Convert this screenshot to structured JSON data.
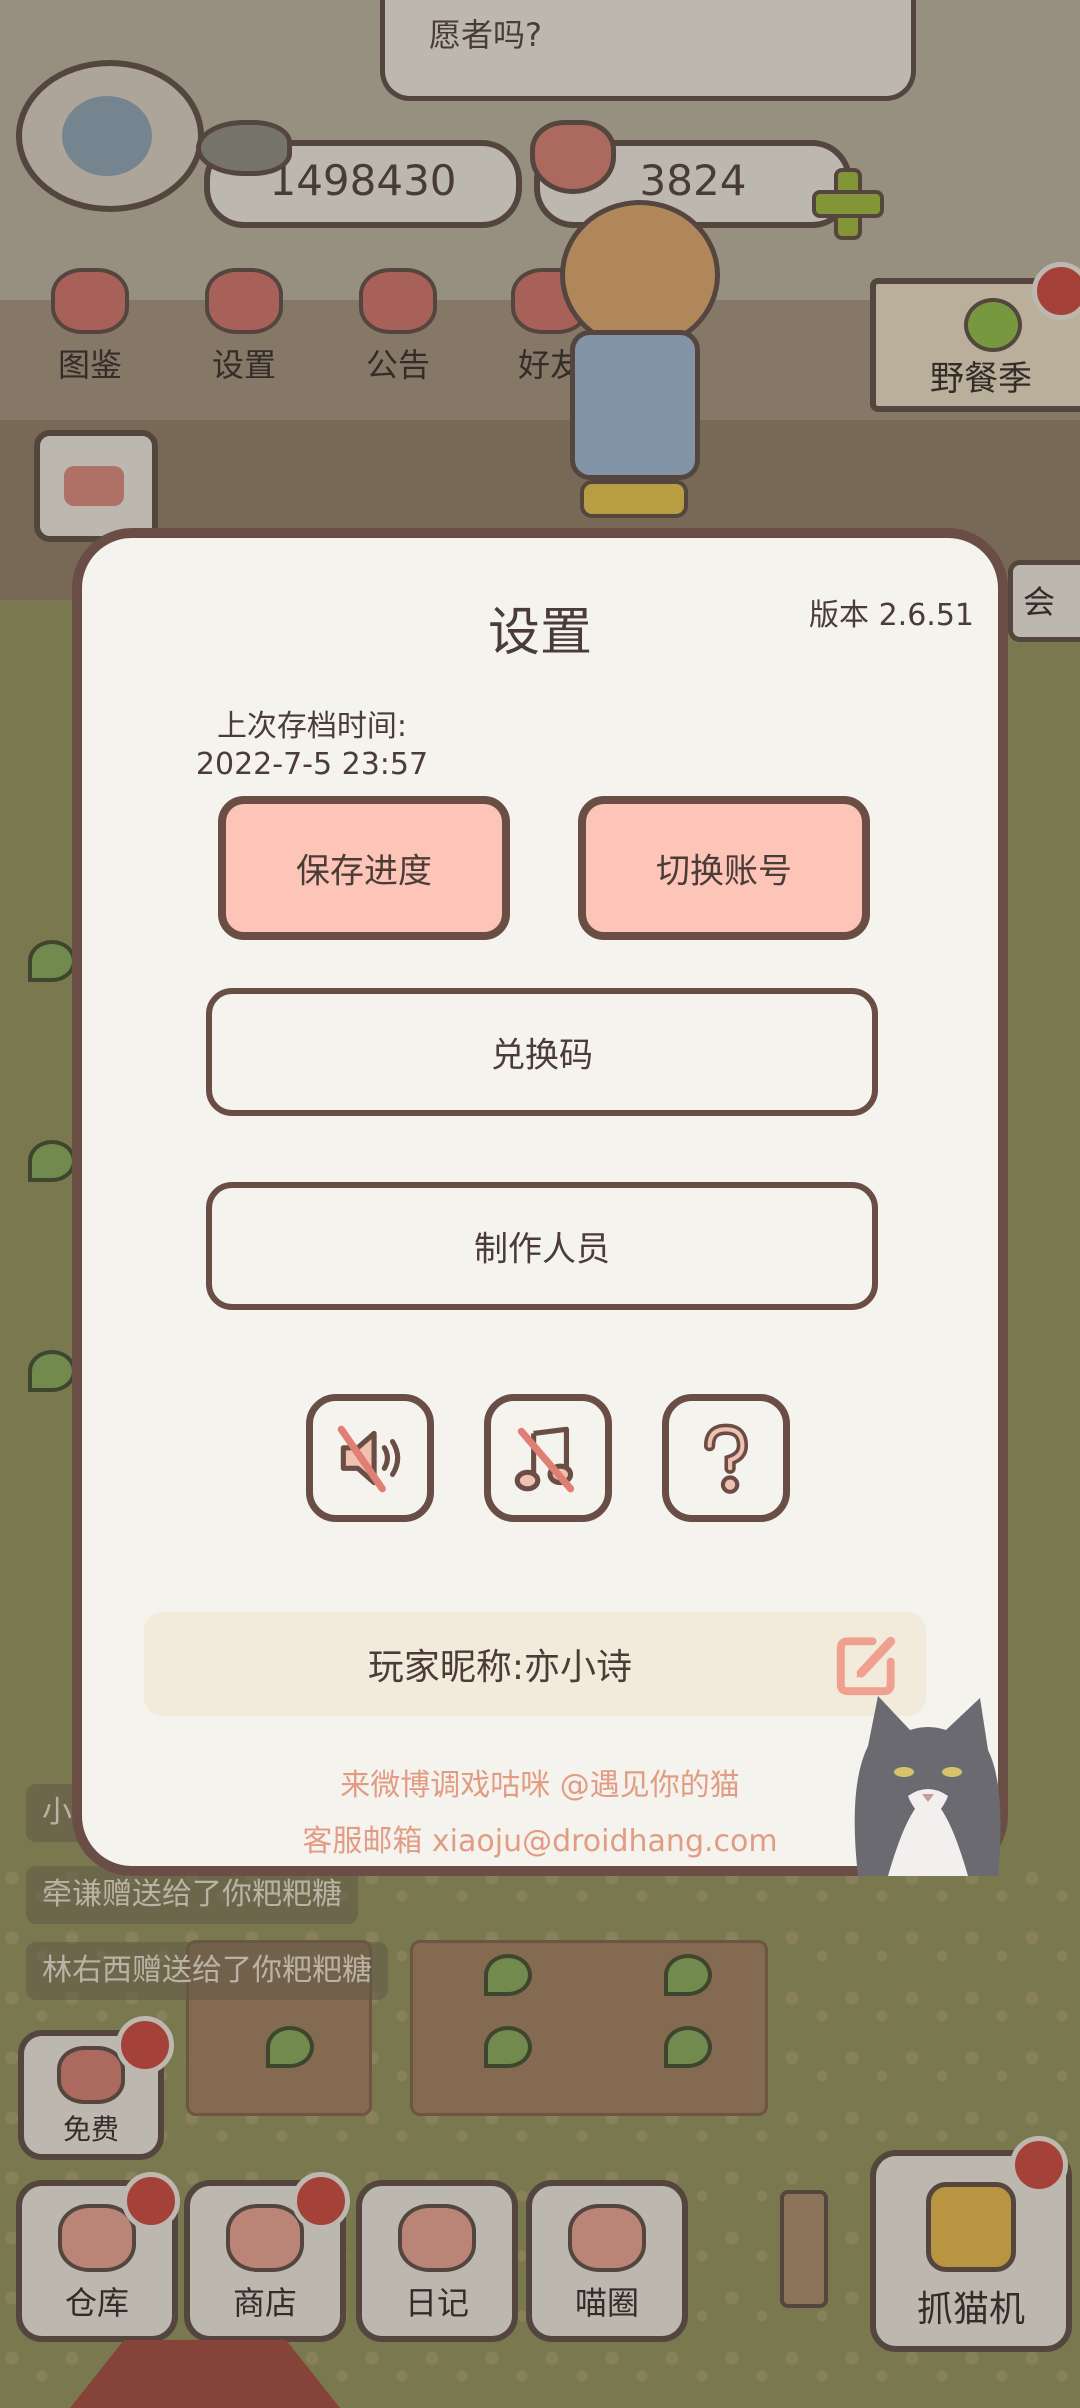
{
  "speech_bubble": "愿者吗?",
  "currencies": {
    "coins": "1498430",
    "hearts": "3824"
  },
  "top_nav": [
    {
      "label": "图鉴",
      "icon": "cat-book-icon"
    },
    {
      "label": "设置",
      "icon": "gear-icon"
    },
    {
      "label": "公告",
      "icon": "gift-icon"
    },
    {
      "label": "好友",
      "icon": "friends-icon"
    }
  ],
  "event_sign": "野餐季",
  "right_peek": "会",
  "activity_feed": [
    "小",
    "牵谦赠送给了你粑粑糖",
    "林右西赠送给了你粑粑糖"
  ],
  "free_button": "免费",
  "bottom_nav": [
    {
      "label": "仓库",
      "icon": "storage-icon"
    },
    {
      "label": "商店",
      "icon": "shop-icon"
    },
    {
      "label": "日记",
      "icon": "diary-icon"
    },
    {
      "label": "喵圈",
      "icon": "cat-planet-icon"
    }
  ],
  "claw_machine": "抓猫机",
  "settings": {
    "title": "设置",
    "version": "版本 2.6.51",
    "last_save_label": "上次存档时间:",
    "last_save_time": "2022-7-5 23:57",
    "save_button": "保存进度",
    "switch_account_button": "切换账号",
    "redeem_code_button": "兑换码",
    "credits_button": "制作人员",
    "icons": [
      "sound-muted-icon",
      "music-muted-icon",
      "help-icon"
    ],
    "nickname_label": "玩家昵称:亦小诗",
    "weibo_text": "来微博调戏咕咪 @遇见你的猫",
    "email_text": "客服邮箱 xiaoju@droidhang.com"
  },
  "colors": {
    "panel_border": "#6a4e46",
    "pink_button": "#fdc4b8",
    "accent_text": "#e39c84"
  }
}
